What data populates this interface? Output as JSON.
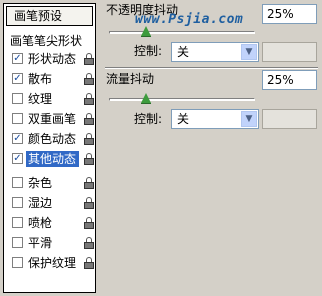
{
  "left": {
    "preset_button": "画笔预设",
    "tip_shape": "画笔笔尖形状",
    "items": [
      {
        "label": "形状动态",
        "checked": true
      },
      {
        "label": "散布",
        "checked": true
      },
      {
        "label": "纹理",
        "checked": false
      },
      {
        "label": "双重画笔",
        "checked": false
      },
      {
        "label": "颜色动态",
        "checked": true
      },
      {
        "label": "其他动态",
        "checked": true,
        "selected": true
      },
      {
        "label": "杂色",
        "checked": false
      },
      {
        "label": "湿边",
        "checked": false
      },
      {
        "label": "喷枪",
        "checked": false
      },
      {
        "label": "平滑",
        "checked": false
      },
      {
        "label": "保护纹理",
        "checked": false
      }
    ]
  },
  "opacity": {
    "label": "不透明度抖动",
    "value": "25%",
    "slider": 0.25,
    "control_label": "控制:",
    "control_value": "关"
  },
  "flow": {
    "label": "流量抖动",
    "value": "25%",
    "slider": 0.25,
    "control_label": "控制:",
    "control_value": "关"
  },
  "watermark": "www.Psjia.com",
  "colors": {
    "selection": "#3169c6",
    "slider_thumb": "#3d9b3d"
  }
}
